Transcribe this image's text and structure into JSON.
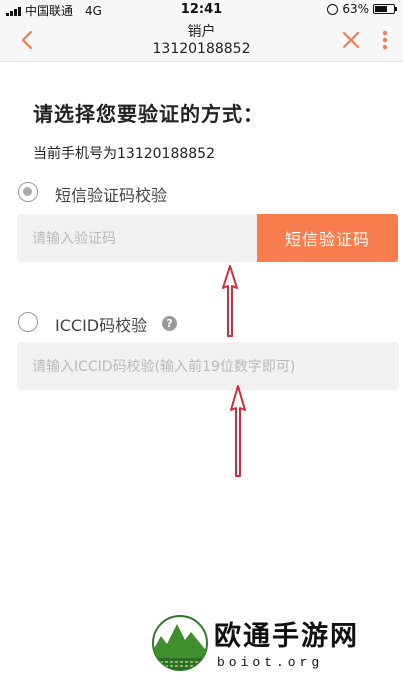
{
  "status_bar": {
    "carrier": "中国联通",
    "network": "4G",
    "time": "12:41",
    "battery": "63%"
  },
  "nav": {
    "title": "销户",
    "subtitle": "13120188852",
    "back_icon": "chevron-left-icon",
    "close_icon": "close-icon",
    "more_icon": "more-vertical-icon",
    "accent_color": "#f87d4e"
  },
  "main": {
    "heading": "请选择您要验证的方式：",
    "phone_line": "当前手机号为13120188852",
    "sms_option": {
      "label": "短信验证码校验",
      "selected": true,
      "input_placeholder": "请输入验证码",
      "button_label": "短信验证码"
    },
    "iccid_option": {
      "label": "ICCID码校验",
      "selected": false,
      "help_icon": "question-circle-icon",
      "help_glyph": "?",
      "input_placeholder": "请输入ICCID码校验(输入前19位数字即可)"
    }
  },
  "watermark": {
    "name": "欧通手游网",
    "domain": "boiot.org",
    "logo_icon": "mountain-logo-icon"
  },
  "annotations": {
    "arrow_color": "#d42b3a"
  }
}
